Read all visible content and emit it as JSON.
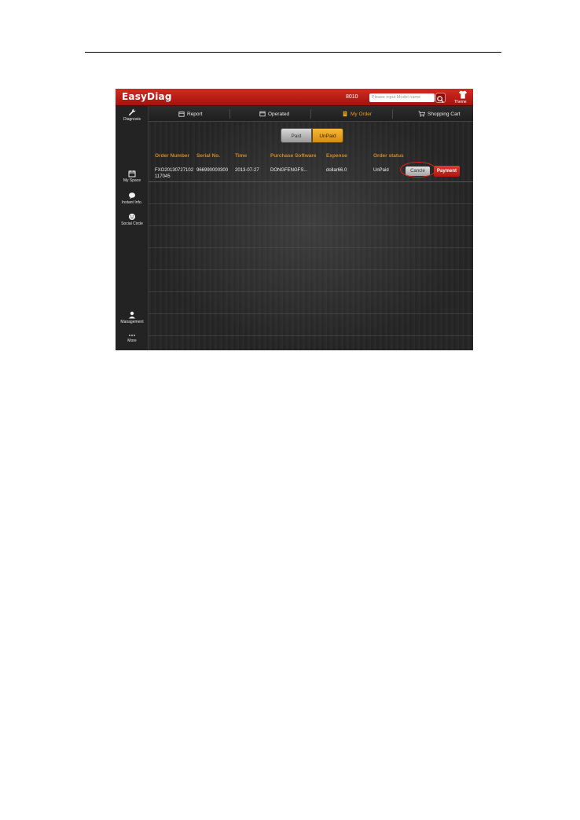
{
  "app": {
    "logo": "EasyDiag",
    "model": "8010",
    "search_placeholder": "Please input Model name",
    "theme_label": "Theme"
  },
  "sidebar": {
    "items": [
      {
        "label": "Diagnosis",
        "icon": "wrench-icon"
      },
      {
        "label": "My Space",
        "icon": "calendar-icon"
      },
      {
        "label": "Instant Info.",
        "icon": "chat-bubble-icon"
      },
      {
        "label": "Social Circle",
        "icon": "smiley-icon"
      },
      {
        "label": "Management",
        "icon": "user-icon"
      },
      {
        "label": "More",
        "icon": "more-dots-icon"
      }
    ]
  },
  "tabs": [
    {
      "label": "Report",
      "icon": "calendar-icon",
      "active": false
    },
    {
      "label": "Operated",
      "icon": "window-icon",
      "active": false
    },
    {
      "label": "My Order",
      "icon": "order-icon",
      "active": true
    },
    {
      "label": "Shopping Cart",
      "icon": "cart-icon",
      "active": false
    }
  ],
  "segment": {
    "paid": "Paid",
    "unpaid": "UnPaid",
    "selected": "UnPaid"
  },
  "table": {
    "headers": [
      "Order Number",
      "Serial No.",
      "Time",
      "Purchase Software",
      "Expense",
      "Order status"
    ],
    "rows": [
      {
        "order_number_line1": "FXO20130727102",
        "order_number_line2": "117045",
        "serial": "966990000300",
        "time": "2013-07-27",
        "software": "DONGFENGFS...",
        "expense": "dollar66.0",
        "status": "UnPaid",
        "cancel_label": "Cancle",
        "payment_label": "Payment"
      }
    ]
  },
  "colors": {
    "brand_red": "#c41d16",
    "accent_orange": "#e6a020",
    "header_text": "#d28a1e"
  }
}
